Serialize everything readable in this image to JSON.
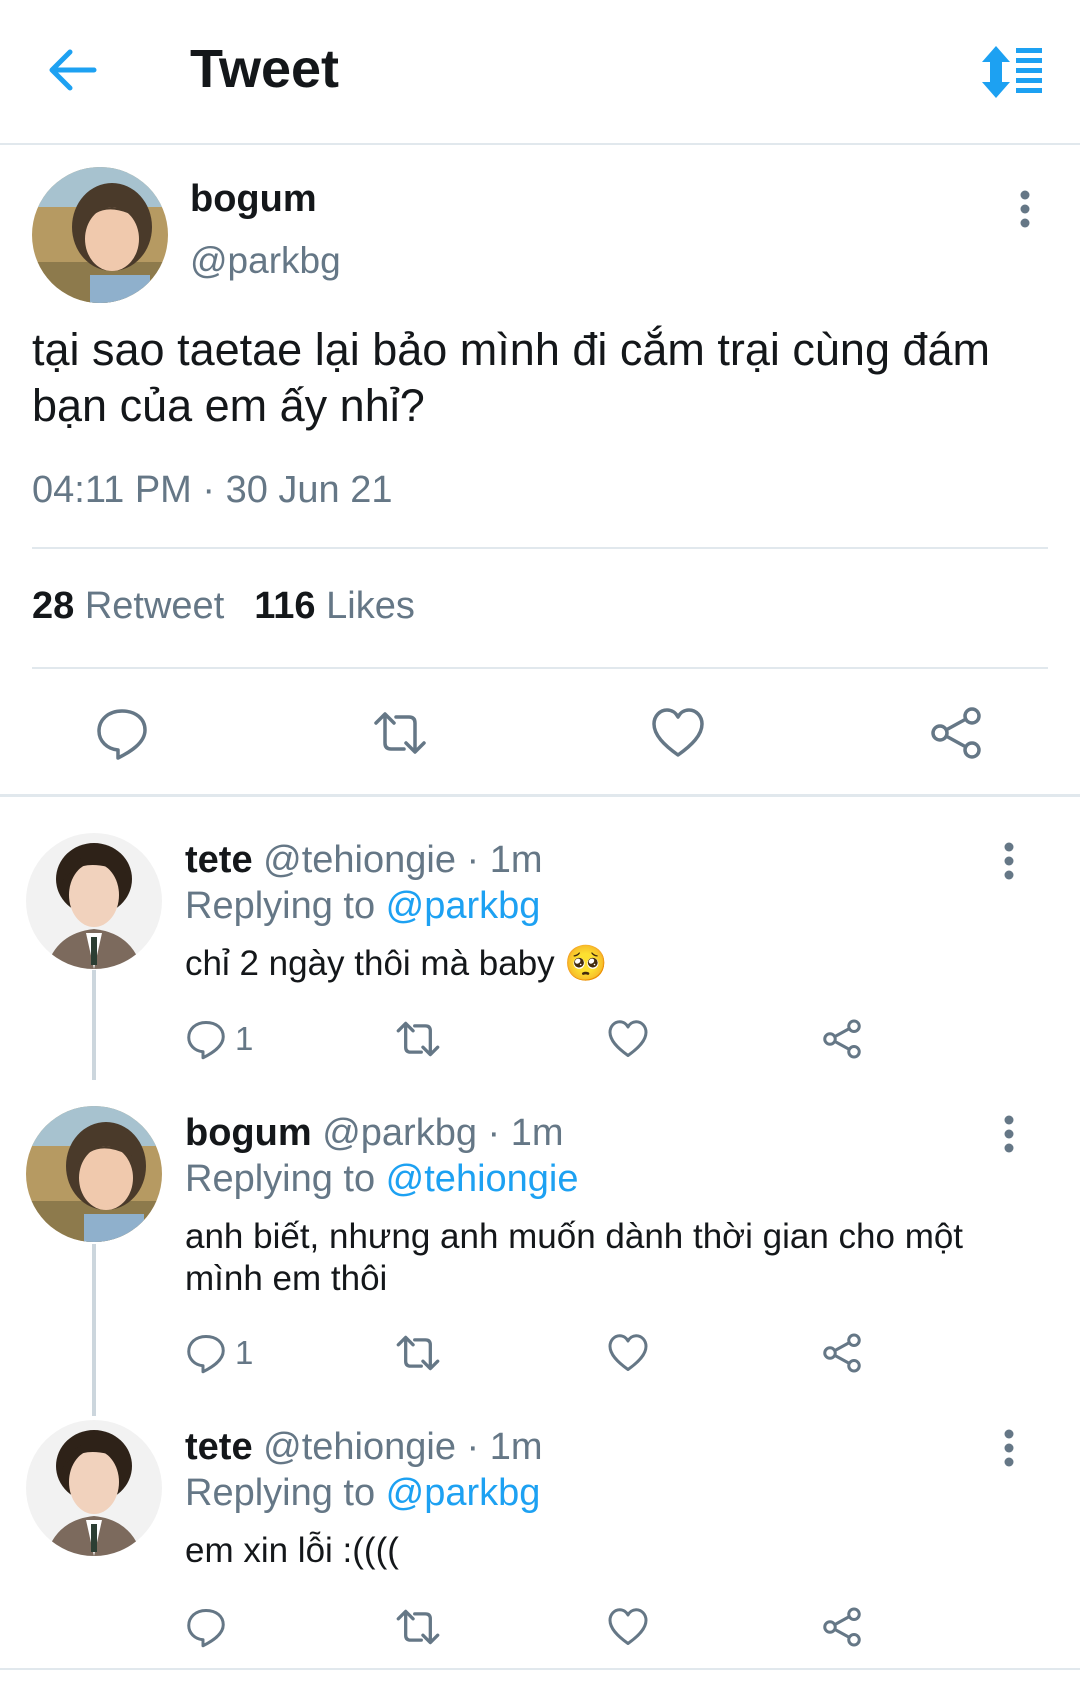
{
  "header": {
    "title": "Tweet"
  },
  "main_tweet": {
    "name": "bogum",
    "handle": "@parkbg",
    "text": "tại sao taetae lại bảo mình đi cắm trại cùng đám bạn của em ấy nhỉ?",
    "time": "04:11 PM · 30 Jun 21",
    "retweets": "28",
    "retweets_label": "Retweet",
    "likes": "116",
    "likes_label": "Likes"
  },
  "replies": [
    {
      "name": "tete",
      "handle": "@tehiongie",
      "sep": " · ",
      "time": "1m",
      "replying_label": "Replying to ",
      "replying_to": "@parkbg",
      "text": "chỉ 2 ngày thôi mà baby 🥺",
      "reply_count": "1"
    },
    {
      "name": "bogum",
      "handle": "@parkbg",
      "sep": " · ",
      "time": "1m",
      "replying_label": "Replying to ",
      "replying_to": "@tehiongie",
      "text": "anh biết, nhưng anh muốn dành thời gian cho một mình em thôi",
      "reply_count": "1"
    },
    {
      "name": "tete",
      "handle": "@tehiongie",
      "sep": " · ",
      "time": "1m",
      "replying_label": "Replying to ",
      "replying_to": "@parkbg",
      "text": "em xin lỗi :((((",
      "reply_count": ""
    }
  ],
  "colors": {
    "accent": "#1da1f2",
    "secondary_text": "#657786",
    "primary_text": "#14171a",
    "divider": "#e1e8ed"
  },
  "icons": {
    "back": "arrow-left-icon",
    "sort": "sort-icon",
    "more": "more-vertical-icon",
    "reply": "reply-icon",
    "retweet": "retweet-icon",
    "like": "heart-icon",
    "share": "share-icon"
  }
}
